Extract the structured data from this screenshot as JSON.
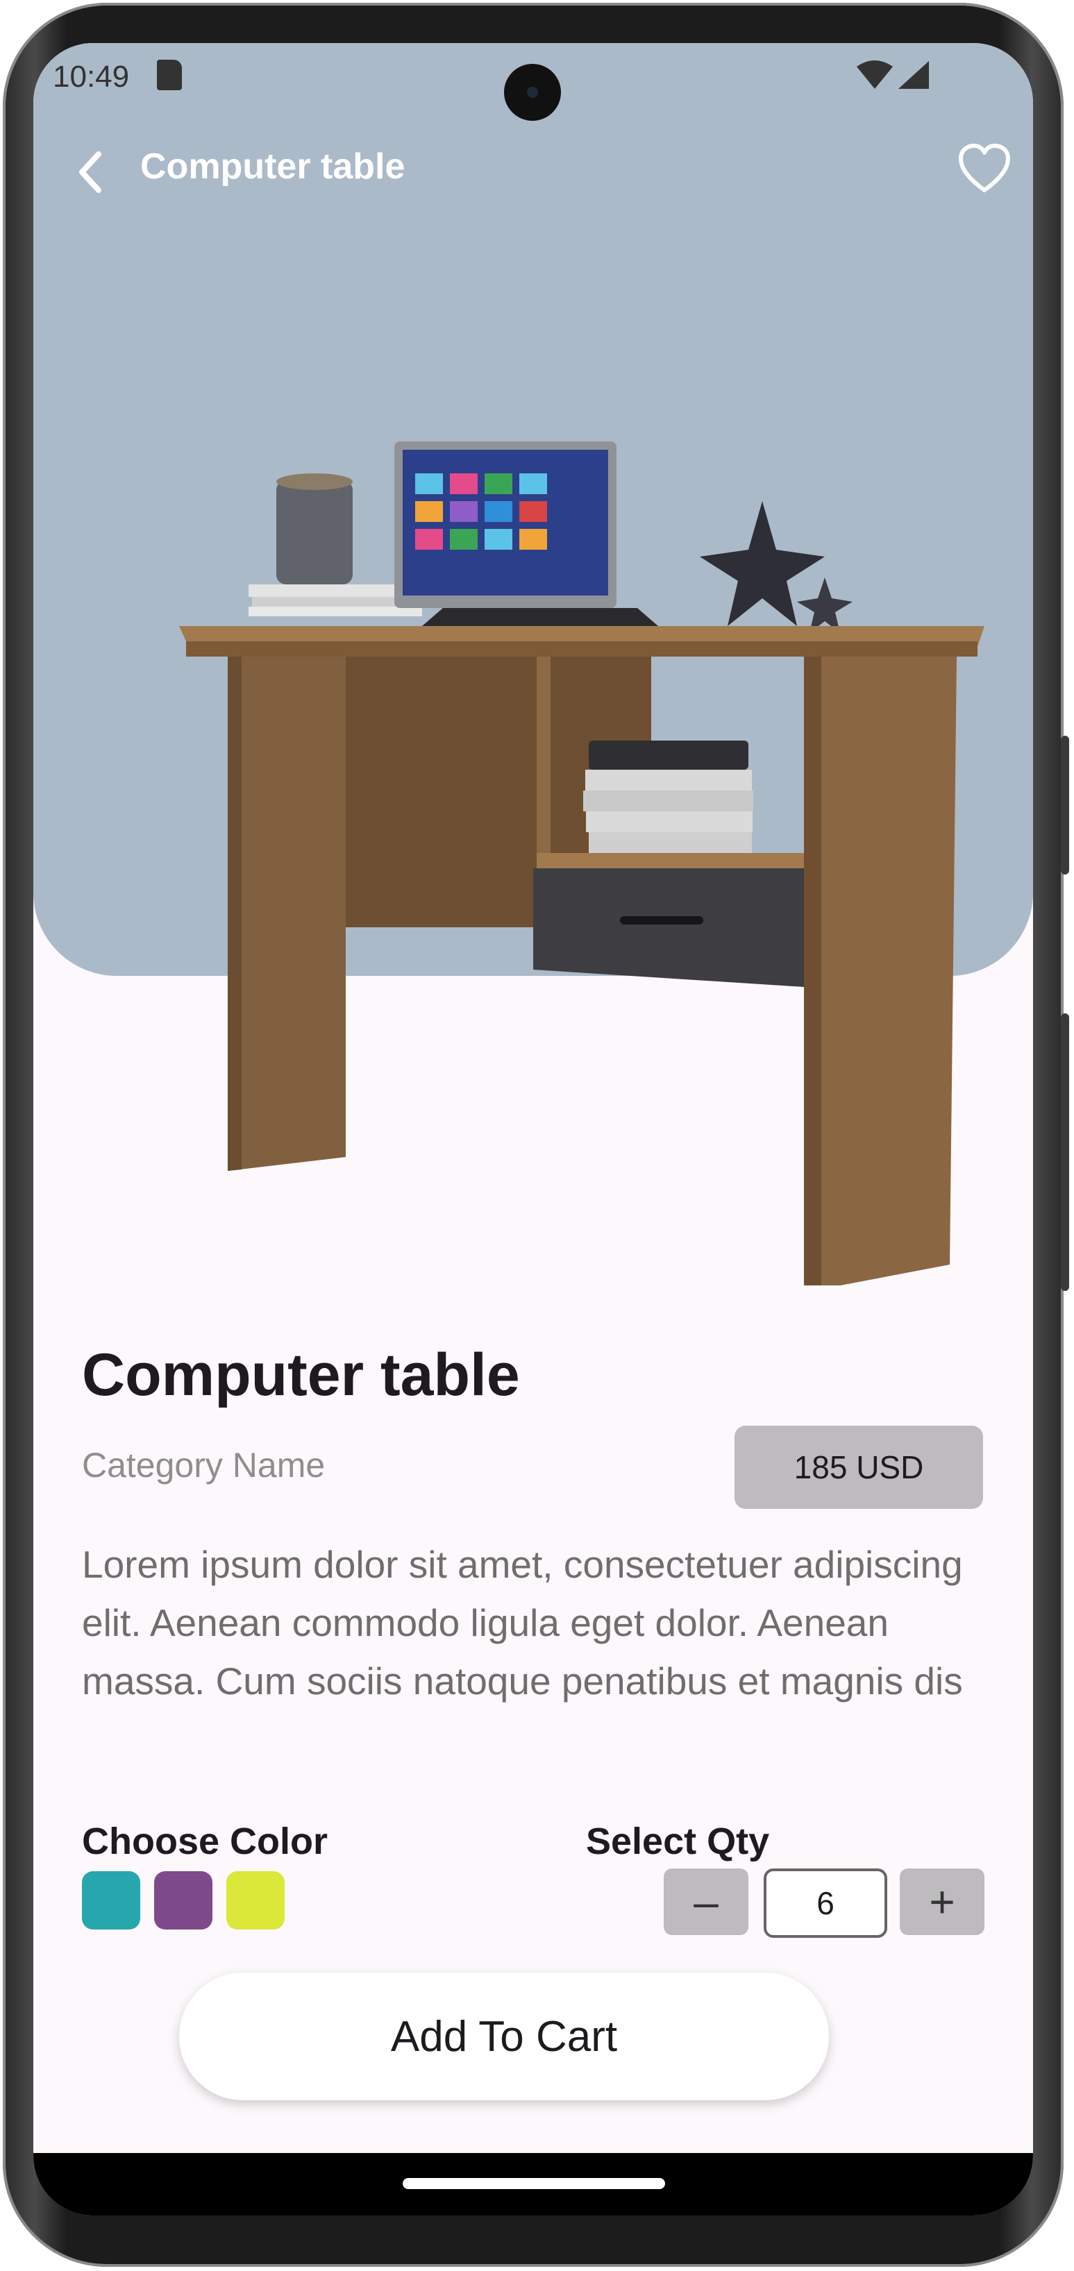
{
  "status_bar": {
    "time": "10:49"
  },
  "header": {
    "title": "Computer table"
  },
  "product": {
    "title": "Computer table",
    "category": "Category Name",
    "price": "185 USD",
    "description": "Lorem ipsum dolor sit amet, consectetuer adipiscing elit. Aenean commodo ligula eget dolor. Aenean massa. Cum sociis natoque penatibus et magnis dis"
  },
  "color_picker": {
    "label": "Choose Color",
    "colors": [
      "#26a7ae",
      "#7e4a8b",
      "#dbe83a"
    ]
  },
  "quantity": {
    "label": "Select Qty",
    "decrement": "–",
    "value": "6",
    "increment": "+"
  },
  "cart": {
    "label": "Add To Cart"
  },
  "theme": {
    "hero_background": "#abbac8",
    "page_background": "#fcf8fb",
    "button_gray": "#bdbbbd"
  },
  "icons": [
    "back-arrow-icon",
    "heart-icon",
    "sd-card-icon",
    "wifi-icon",
    "signal-icon"
  ]
}
